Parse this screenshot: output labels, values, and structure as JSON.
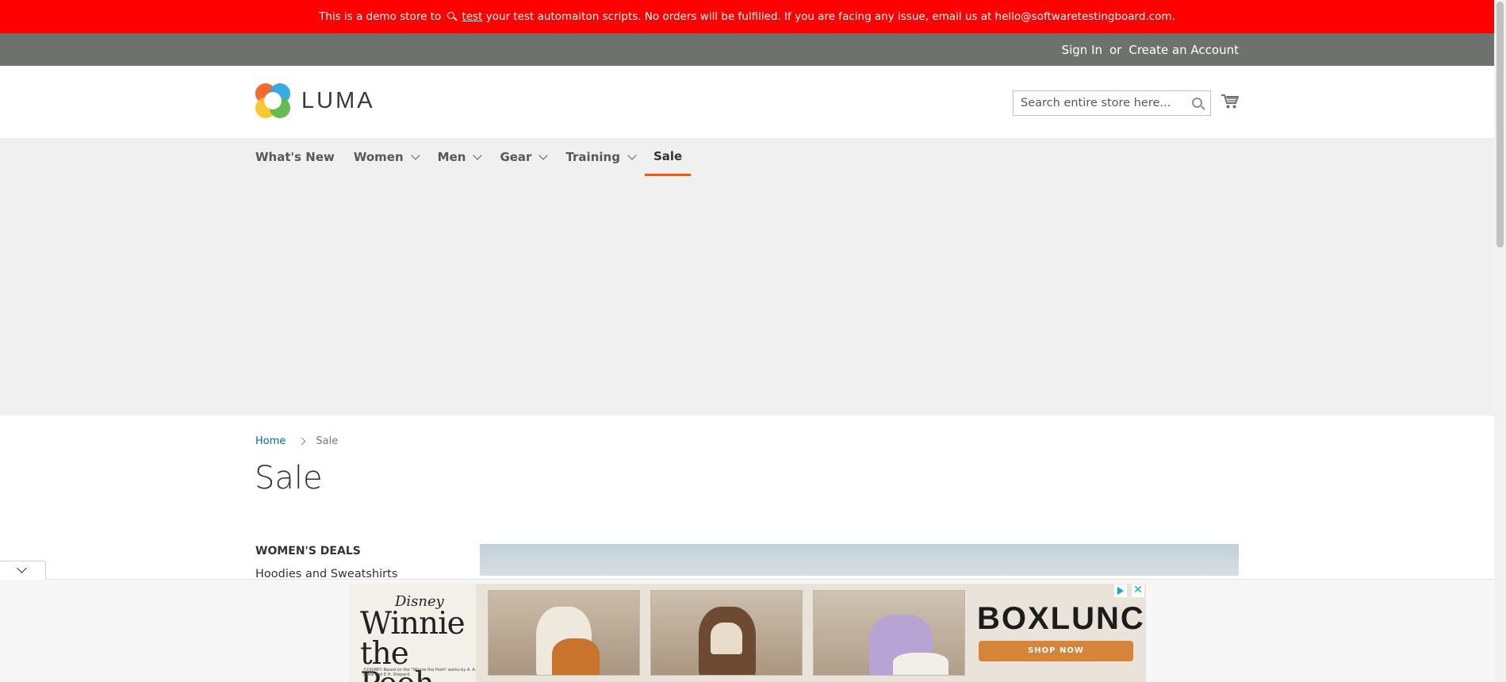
{
  "notice": {
    "prefix": "This is a demo store to",
    "link": "test",
    "suffix": "your test automaiton scripts. No orders will be fulfilled. If you are facing any issue, email us at hello@softwaretestingboard.com."
  },
  "header": {
    "sign_in": "Sign In",
    "or": "or",
    "create_account": "Create an Account"
  },
  "logo": {
    "text": "LUMA"
  },
  "search": {
    "placeholder": "Search entire store here..."
  },
  "nav": {
    "items": [
      {
        "label": "What's New"
      },
      {
        "label": "Women"
      },
      {
        "label": "Men"
      },
      {
        "label": "Gear"
      },
      {
        "label": "Training"
      },
      {
        "label": "Sale"
      }
    ],
    "active": "Sale",
    "accent": "#ff5501"
  },
  "breadcrumb": {
    "home": "Home",
    "current": "Sale"
  },
  "page": {
    "title": "Sale"
  },
  "sidebar": {
    "heading": "WOMEN'S DEALS",
    "link": "Hoodies and Sweatshirts"
  },
  "ad": {
    "brand_small": "Disney",
    "title_line1": "Winnie",
    "title_line2": "the Pooh",
    "brand": "BOXLUNCH",
    "cta": "SHOP NOW",
    "fine_print": "©DISNEY. Based on the \"Winnie the Pooh\" works by A. A. Milne and E.H. Shepard."
  },
  "colors": {
    "notice_bg": "#ff0000",
    "panel_bg": "#6e716e",
    "link": "#006bb4"
  }
}
